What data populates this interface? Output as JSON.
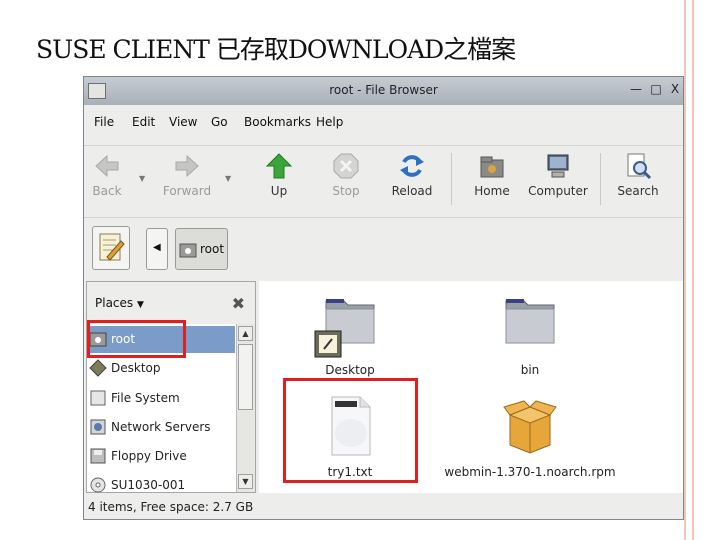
{
  "slide": {
    "title": "SUSE CLIENT 已存取DOWNLOAD之檔案"
  },
  "window": {
    "title": "root - File Browser",
    "controls": [
      "minimize-icon",
      "maximize-icon",
      "close-icon"
    ],
    "minimize_glyph": "—",
    "maximize_glyph": "□",
    "close_glyph": "X"
  },
  "menu": [
    "File",
    "Edit",
    "View",
    "Go",
    "Bookmarks",
    "Help"
  ],
  "toolbar": {
    "back": "Back",
    "forward": "Forward",
    "up": "Up",
    "stop": "Stop",
    "reload": "Reload",
    "home": "Home",
    "computer": "Computer",
    "search": "Search"
  },
  "location": {
    "crumb": "root"
  },
  "sidebar": {
    "header": "Places",
    "close_glyph": "✖",
    "items": [
      "root",
      "Desktop",
      "File System",
      "Network Servers",
      "Floppy Drive",
      "SU1030-001"
    ]
  },
  "files": [
    {
      "name": "Desktop",
      "icon": "folder-icon"
    },
    {
      "name": "bin",
      "icon": "folder-icon"
    },
    {
      "name": "try1.txt",
      "icon": "text-file-icon"
    },
    {
      "name": "webmin-1.370-1.noarch.rpm",
      "icon": "package-icon"
    }
  ],
  "status": "4 items, Free space: 2.7 GB",
  "colors": {
    "highlight": "#e02020",
    "selection": "#7b9cc8"
  }
}
